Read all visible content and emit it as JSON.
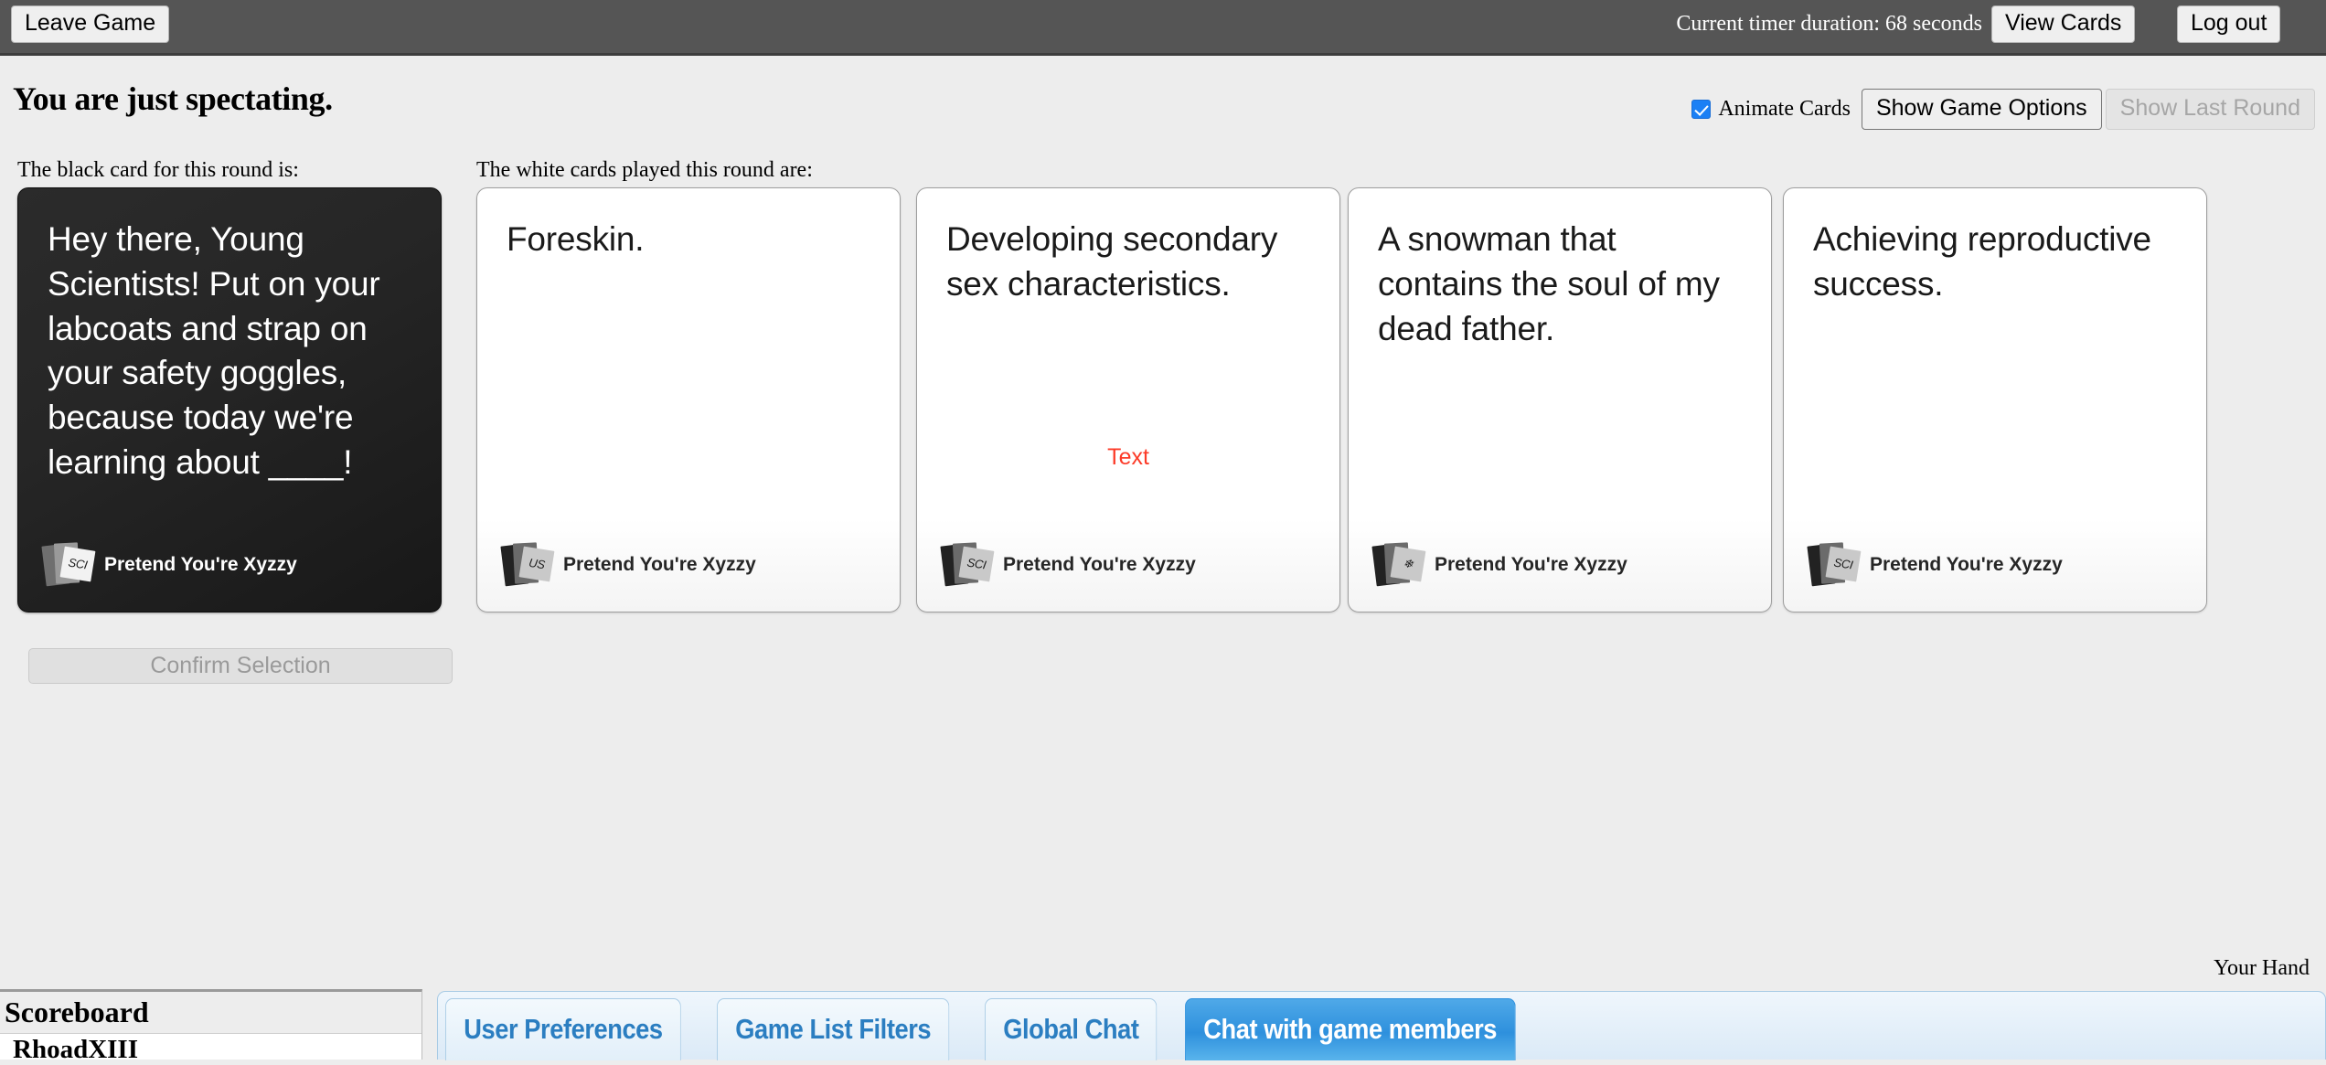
{
  "navbar": {
    "leave_game_label": "Leave Game",
    "timer_text": "Current timer duration: 68 seconds",
    "view_cards_label": "View Cards",
    "logout_label": "Log out"
  },
  "header": {
    "title": "You are just spectating.",
    "animate_cards_label": "Animate Cards",
    "animate_cards_checked": "true",
    "show_game_options_label": "Show Game Options",
    "show_last_round_label": "Show Last Round"
  },
  "labels": {
    "black_card_label": "The black card for this round is:",
    "white_cards_label": "The white cards played this round are:",
    "your_hand_label": "Your Hand"
  },
  "black_card": {
    "text": "Hey there, Young Scientists! Put on your labcoats and strap on your safety goggles, because today we're learning about ____!",
    "brand": "Pretend You're Xyzzy",
    "deck_tag": "SCI"
  },
  "white_cards": [
    {
      "text": "Foreskin.",
      "brand": "Pretend You're Xyzzy",
      "deck_tag": "US",
      "annotation": ""
    },
    {
      "text": "Developing secondary sex characteristics.",
      "brand": "Pretend You're Xyzzy",
      "deck_tag": "SCI",
      "annotation": "Text"
    },
    {
      "text": "A snowman that contains the soul of my dead father.",
      "brand": "Pretend You're Xyzzy",
      "deck_tag": "❄",
      "annotation": ""
    },
    {
      "text": "Achieving reproductive success.",
      "brand": "Pretend You're Xyzzy",
      "deck_tag": "SCI",
      "annotation": ""
    }
  ],
  "confirm_selection_label": "Confirm Selection",
  "scoreboard": {
    "title": "Scoreboard",
    "players": [
      {
        "name": "RhoadXIII"
      }
    ]
  },
  "tabs": [
    {
      "label": "User Preferences",
      "active": "false"
    },
    {
      "label": "Game List Filters",
      "active": "false"
    },
    {
      "label": "Global Chat",
      "active": "false"
    },
    {
      "label": "Chat with game members",
      "active": "true"
    }
  ],
  "colors": {
    "navbar_bg": "#555555",
    "page_bg": "#ededed",
    "accent_blue": "#2e90dd",
    "checkbox_blue": "#1b80f5",
    "annotation_red": "#fc3b28",
    "black_card_bg": "#232323"
  }
}
